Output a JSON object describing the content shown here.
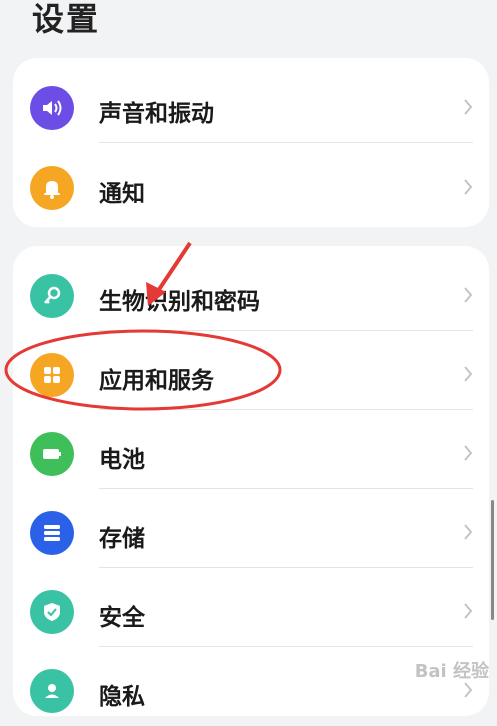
{
  "header": {
    "title": "设置"
  },
  "groups": [
    {
      "items": [
        {
          "label": "声音和振动",
          "icon": "speaker-icon",
          "color": "#6c4de6"
        },
        {
          "label": "通知",
          "icon": "bell-icon",
          "color": "#f5a623"
        }
      ]
    },
    {
      "items": [
        {
          "label": "生物识别和密码",
          "icon": "key-icon",
          "color": "#39c2a3"
        },
        {
          "label": "应用和服务",
          "icon": "apps-grid-icon",
          "color": "#f5a623"
        },
        {
          "label": "电池",
          "icon": "battery-icon",
          "color": "#3fbf5a"
        },
        {
          "label": "存储",
          "icon": "storage-icon",
          "color": "#2a61e8"
        },
        {
          "label": "安全",
          "icon": "shield-icon",
          "color": "#39c2a3"
        },
        {
          "label": "隐私",
          "icon": "privacy-icon",
          "color": "#39c2a3"
        }
      ]
    }
  ],
  "watermark": "Bai 经验"
}
